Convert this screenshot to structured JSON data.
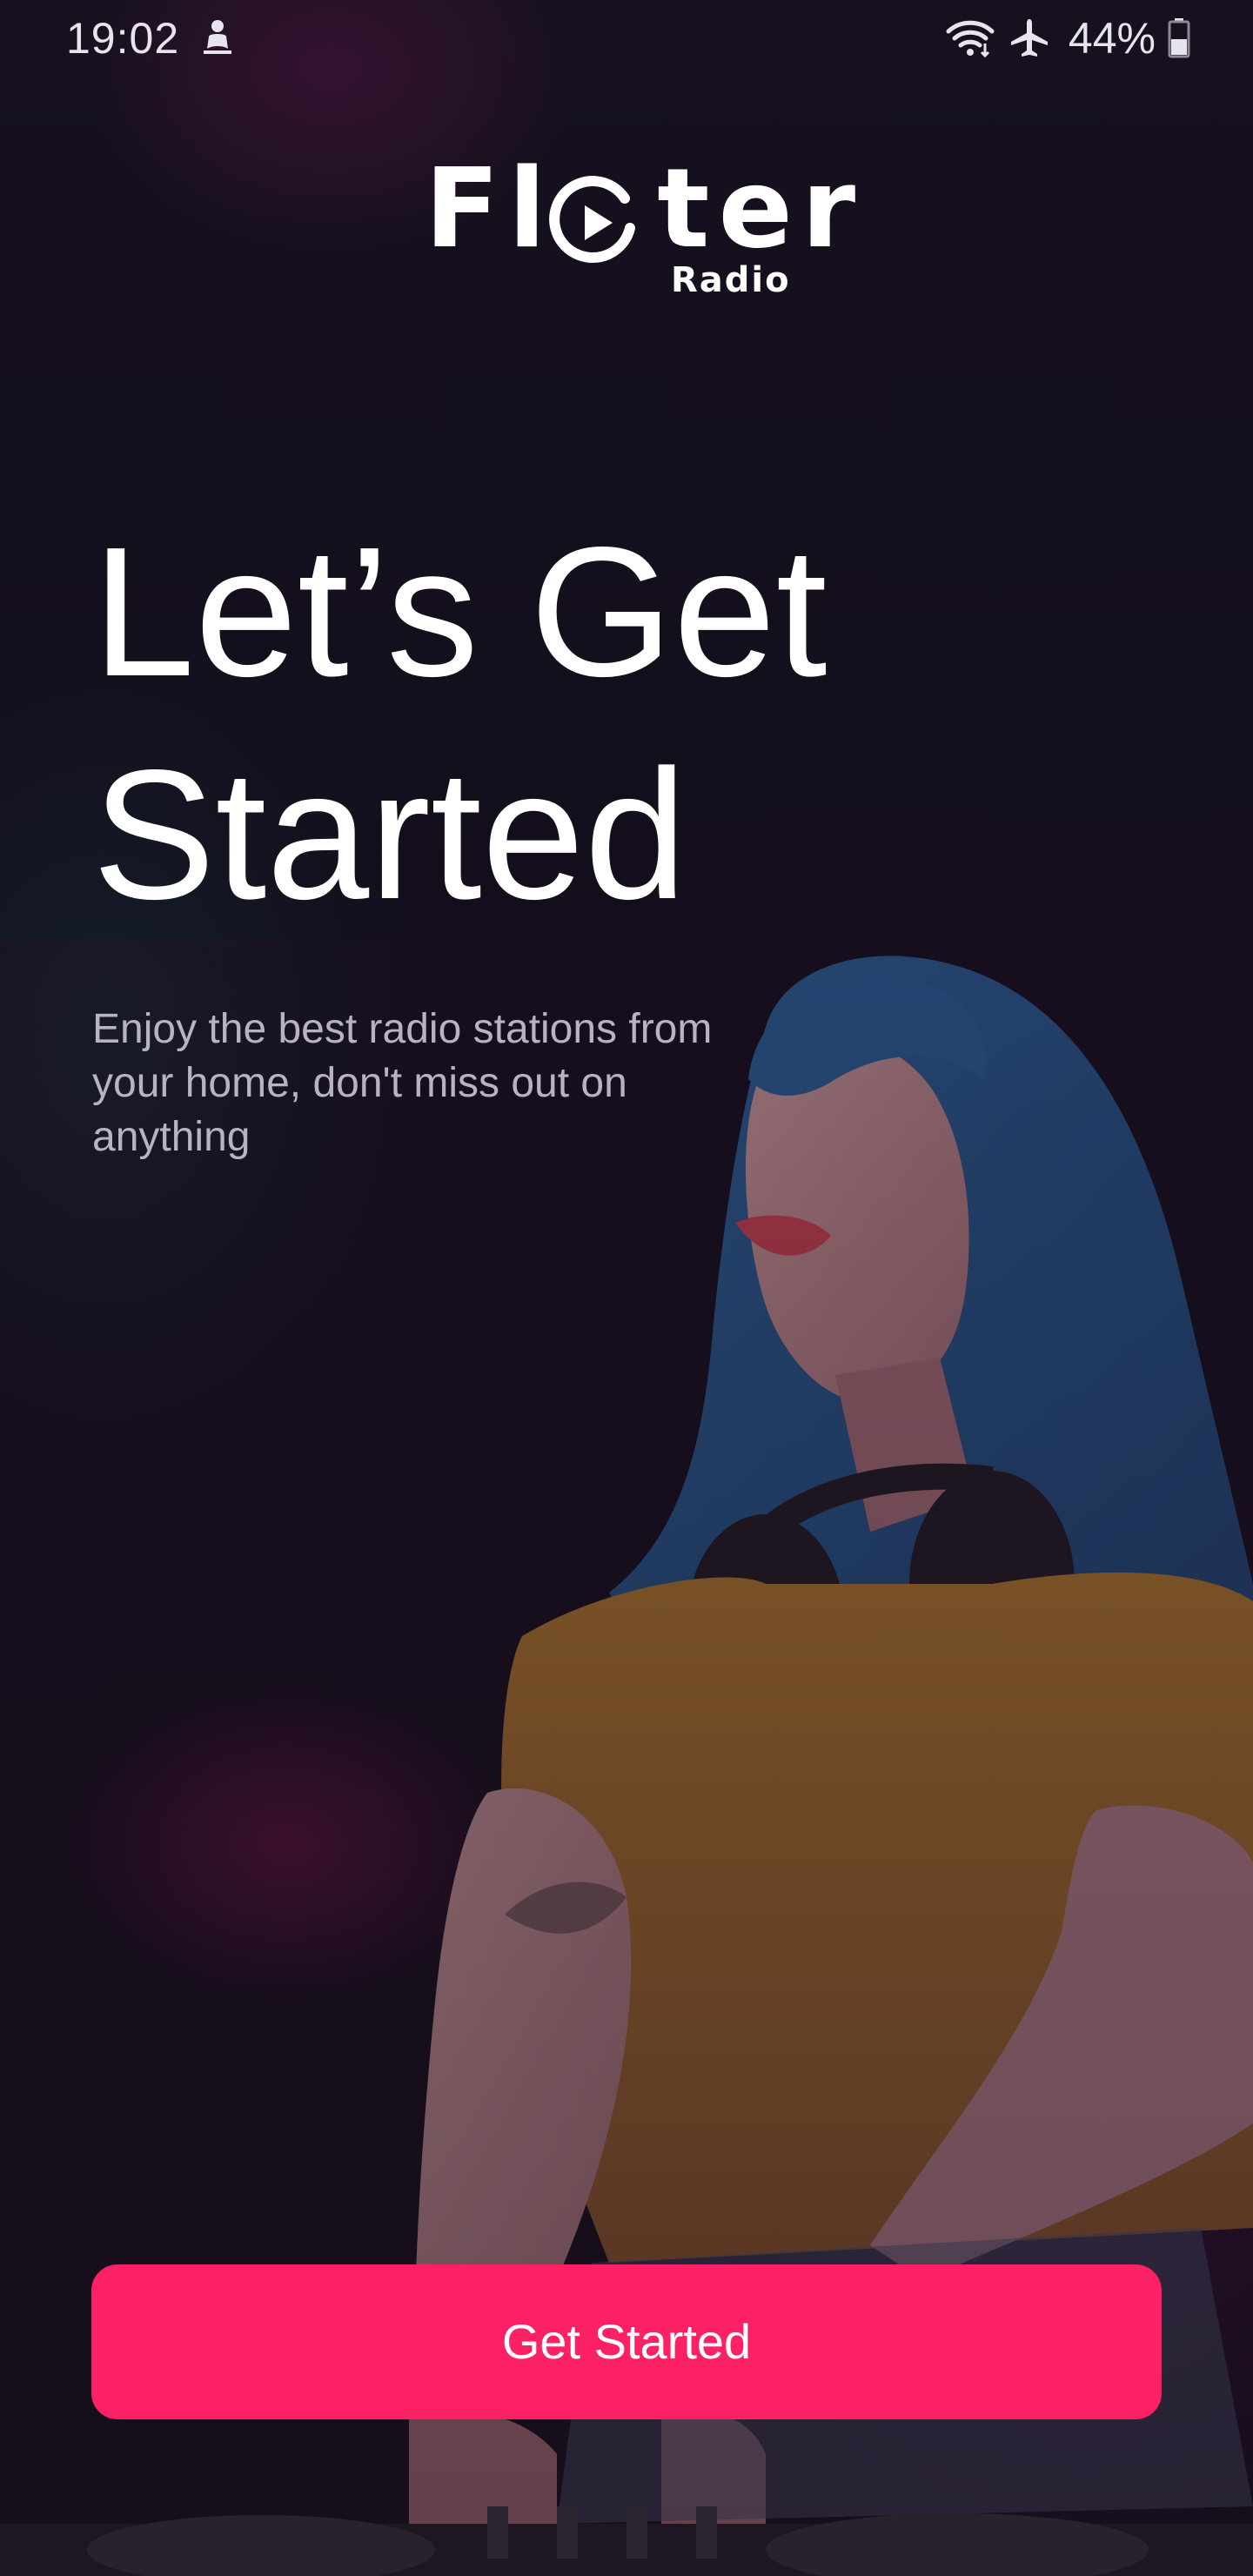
{
  "status_bar": {
    "time": "19:02",
    "battery_percent": "44%",
    "icons": [
      "notification-person-icon",
      "wifi-icon",
      "airplane-mode-icon",
      "battery-icon"
    ],
    "battery_level": 0.44
  },
  "logo": {
    "wordmark_prefix": "Fl",
    "wordmark_suffix": "ter",
    "wordmark_tagline": "Radio",
    "icon": "play-circle-icon"
  },
  "hero": {
    "title_line_1": "Let’s Get",
    "title_line_2": "Started",
    "subtitle": "Enjoy the best radio stations from your home, don't miss out on anything"
  },
  "cta": {
    "label": "Get Started"
  },
  "colors": {
    "accent": "#fb2164",
    "background": "#130e1b",
    "text_primary": "#ffffff",
    "text_secondary": "#b9b2c4"
  }
}
